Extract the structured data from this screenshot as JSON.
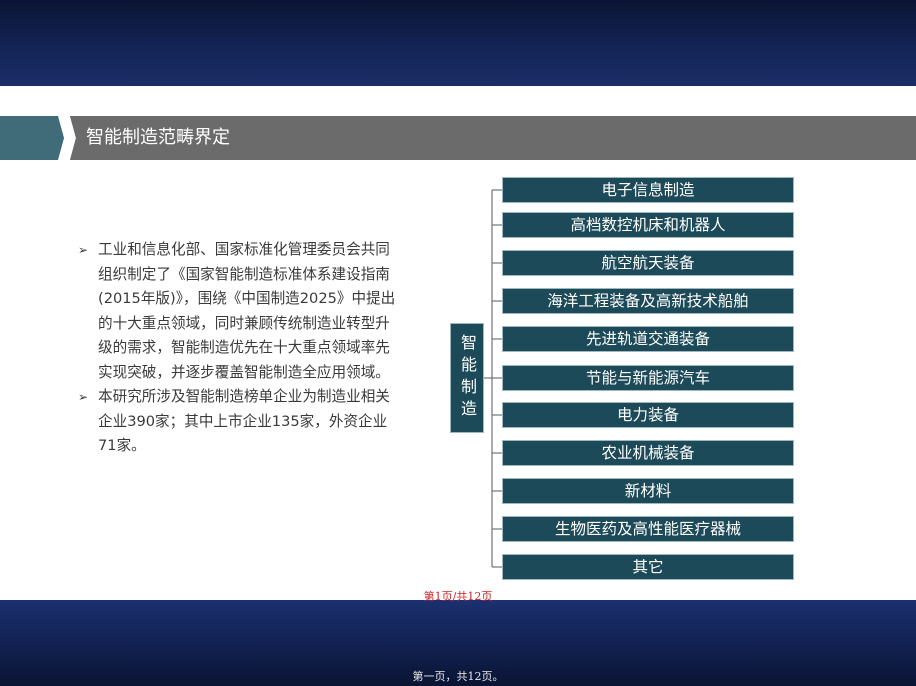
{
  "slide": {
    "title": "智能制造范畴界定"
  },
  "bullets": [
    {
      "marker": "➢",
      "text": "工业和信息化部、国家标准化管理委员会共同组织制定了《国家智能制造标准体系建设指南(2015年版)》，围绕《中国制造2025》中提出的十大重点领域，同时兼顾传统制造业转型升级的需求，智能制造优先在十大重点领域率先实现突破，并逐步覆盖智能制造全应用领域。"
    },
    {
      "marker": "➢",
      "text": "本研究所涉及智能制造榜单企业为制造业相关企业390家；其中上市企业135家，外资企业71家。"
    }
  ],
  "tree": {
    "root": "智能制造",
    "categories": [
      "电子信息制造",
      "高档数控机床和机器人",
      "航空航天装备",
      "海洋工程装备及高新技术船舶",
      "先进轨道交通装备",
      "节能与新能源汽车",
      "电力装备",
      "农业机械装备",
      "新材料",
      "生物医药及高性能医疗器械",
      "其它"
    ]
  },
  "page_indicator": "第1页/共12页",
  "footer_page": "第一页，共12页。",
  "colors": {
    "band": "#142455",
    "title_bar": "#6b6b6b",
    "box_fill": "#1d4a58",
    "page_indicator": "#cc2222"
  }
}
